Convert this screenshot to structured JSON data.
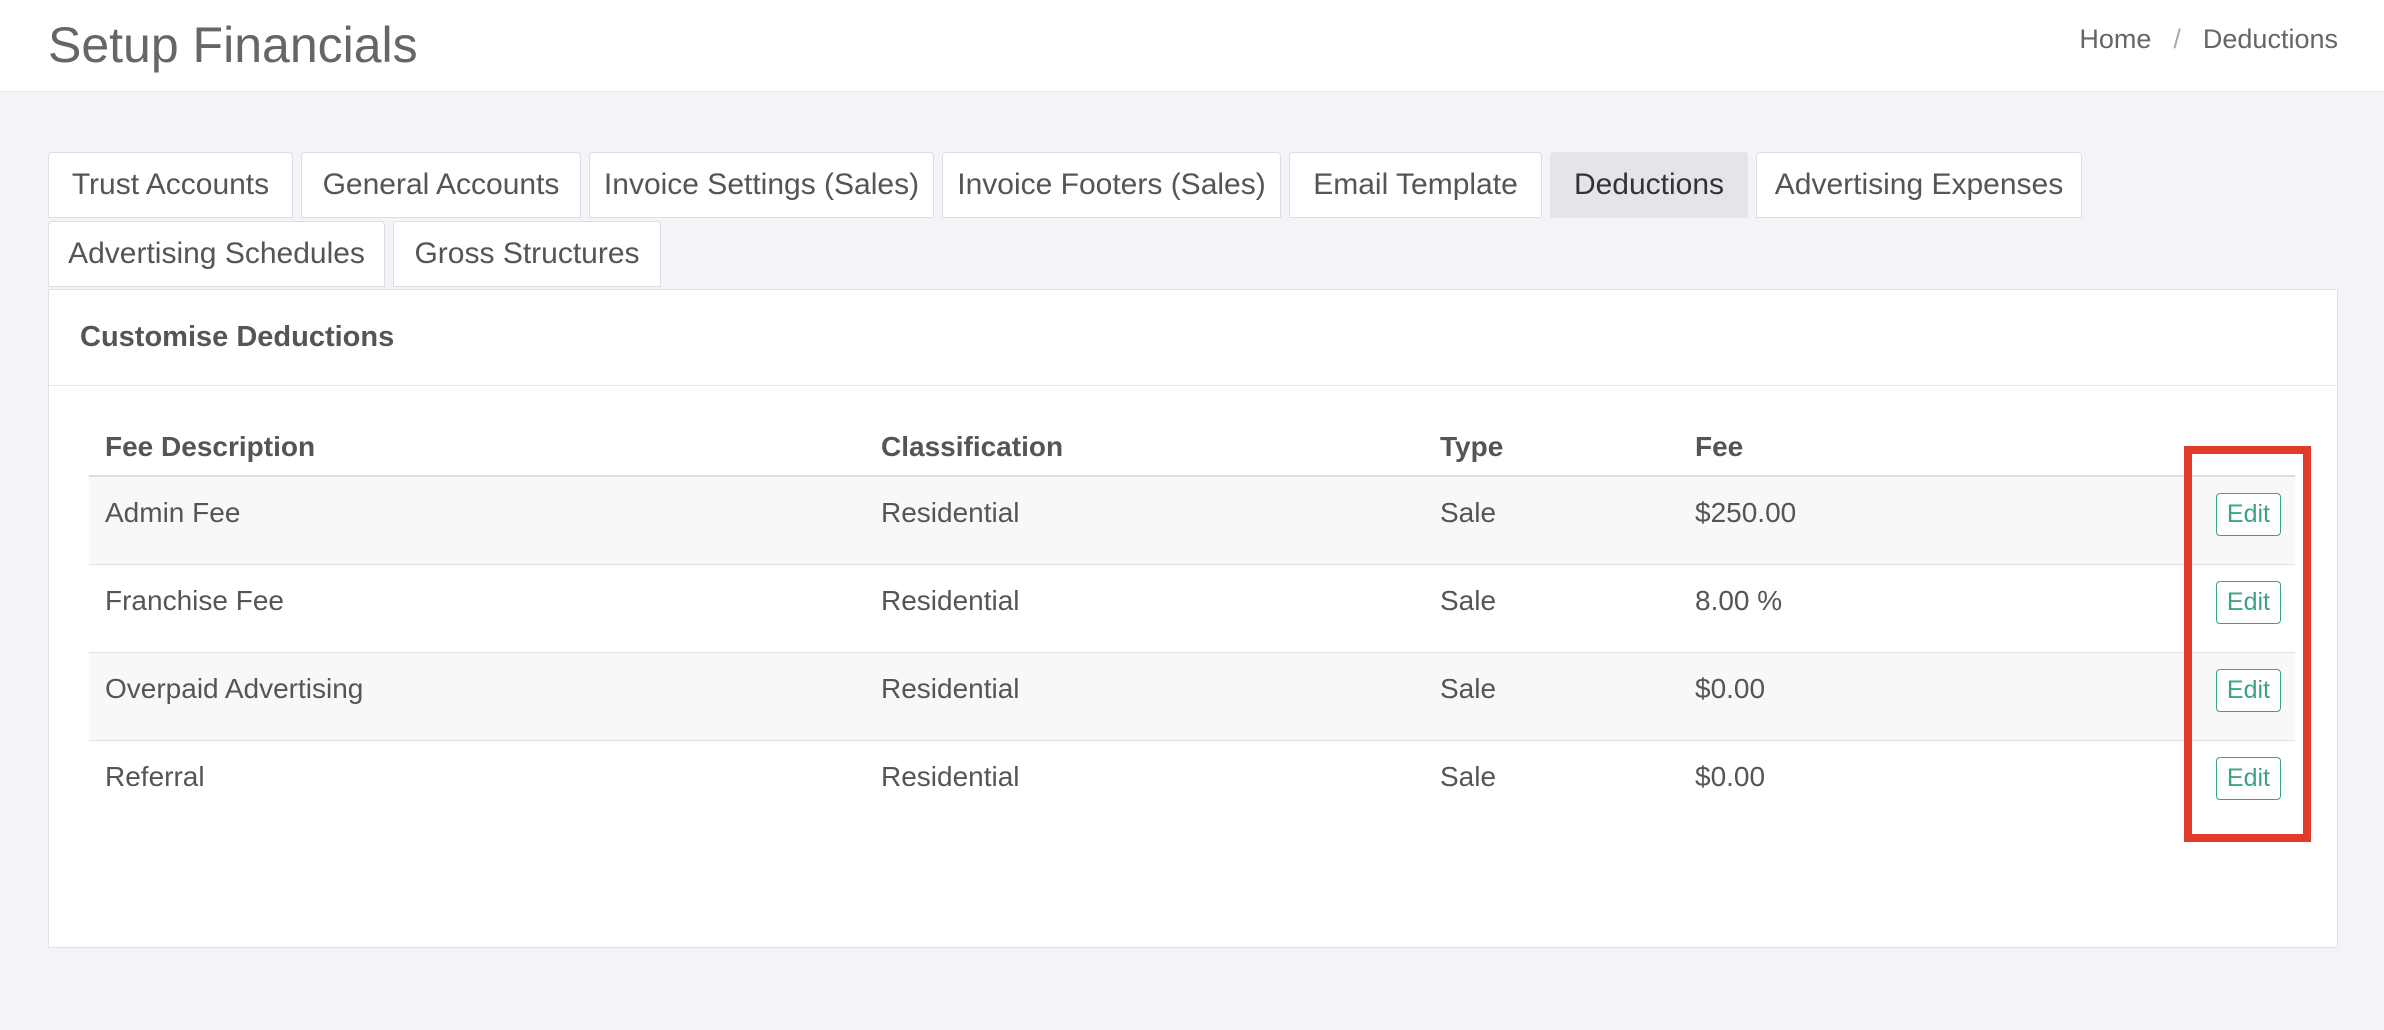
{
  "header": {
    "title": "Setup Financials",
    "breadcrumb": [
      "Home",
      "Deductions"
    ]
  },
  "tabs": [
    {
      "label": "Trust Accounts",
      "active": false
    },
    {
      "label": "General Accounts",
      "active": false
    },
    {
      "label": "Invoice Settings (Sales)",
      "active": false
    },
    {
      "label": "Invoice Footers (Sales)",
      "active": false
    },
    {
      "label": "Email Template",
      "active": false
    },
    {
      "label": "Deductions",
      "active": true
    },
    {
      "label": "Advertising Expenses",
      "active": false
    },
    {
      "label": "Advertising Schedules",
      "active": false
    },
    {
      "label": "Gross Structures",
      "active": false
    }
  ],
  "panel": {
    "title": "Customise Deductions",
    "columns": [
      "Fee Description",
      "Classification",
      "Type",
      "Fee",
      ""
    ],
    "rows": [
      {
        "description": "Admin Fee",
        "classification": "Residential",
        "type": "Sale",
        "fee": "$250.00",
        "action": "Edit"
      },
      {
        "description": "Franchise Fee",
        "classification": "Residential",
        "type": "Sale",
        "fee": "8.00 %",
        "action": "Edit"
      },
      {
        "description": "Overpaid Advertising",
        "classification": "Residential",
        "type": "Sale",
        "fee": "$0.00",
        "action": "Edit"
      },
      {
        "description": "Referral",
        "classification": "Residential",
        "type": "Sale",
        "fee": "$0.00",
        "action": "Edit"
      }
    ]
  },
  "colors": {
    "accent": "#3aa38a",
    "highlight": "#e13c2a",
    "active_tab": "#e4e5e8",
    "background": "#f3f4f8"
  }
}
